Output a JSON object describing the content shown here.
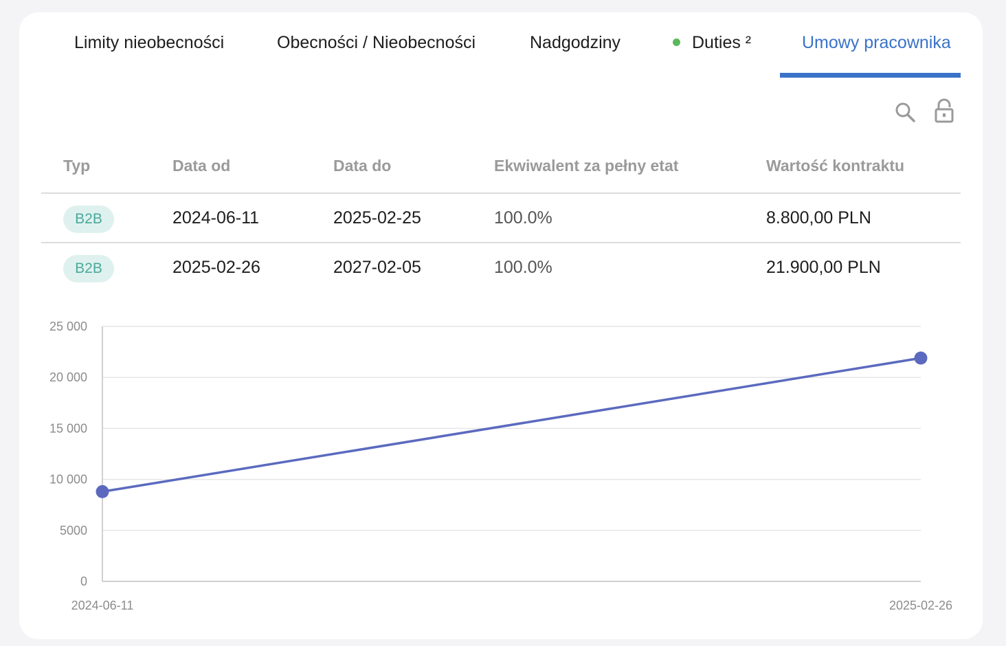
{
  "tabs": [
    {
      "label": "Limity nieobecności",
      "active": false
    },
    {
      "label": "Obecności / Nieobecności",
      "active": false
    },
    {
      "label": "Nadgodziny",
      "active": false
    },
    {
      "label": "Duties ²",
      "active": false,
      "status_dot_color": "#5cb85c"
    },
    {
      "label": "Umowy pracownika",
      "active": true
    }
  ],
  "accent_color": "#3a72c8",
  "toolbar": {
    "icons": [
      "search-icon",
      "lock-open-icon"
    ]
  },
  "table": {
    "headers": [
      "Typ",
      "Data od",
      "Data do",
      "Ekwiwalent za pełny etat",
      "Wartość kontraktu"
    ],
    "rows": [
      {
        "type": "B2B",
        "from": "2024-06-11",
        "to": "2025-02-25",
        "fte": "100.0%",
        "value": "8.800,00 PLN"
      },
      {
        "type": "B2B",
        "from": "2025-02-26",
        "to": "2027-02-05",
        "fte": "100.0%",
        "value": "21.900,00 PLN"
      }
    ]
  },
  "chart_data": {
    "type": "line",
    "x": [
      "2024-06-11",
      "2025-02-26"
    ],
    "series": [
      {
        "values": [
          8800,
          21900
        ],
        "color": "#5b6abf"
      }
    ],
    "ylim": [
      0,
      25000
    ],
    "y_ticks": [
      "0",
      "5000",
      "10 000",
      "15 000",
      "20 000",
      "25 000"
    ],
    "y_tick_values": [
      0,
      5000,
      10000,
      15000,
      20000,
      25000
    ],
    "x_tick_labels": [
      "2024-06-11",
      "2025-02-26"
    ],
    "grid": true,
    "legend": "none",
    "title": "",
    "xlabel": "",
    "ylabel": ""
  }
}
